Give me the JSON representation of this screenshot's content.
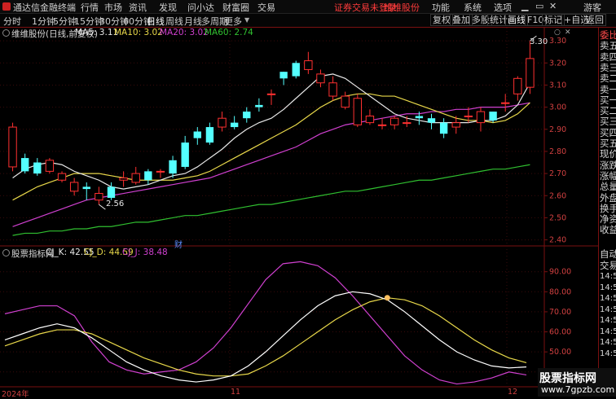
{
  "window": {
    "app_title": "通达信金融终端",
    "menu": [
      "行情",
      "市场",
      "资讯",
      "发现",
      "问小达",
      "财富圈",
      "交易"
    ],
    "login_notice": "证券交易未登录",
    "stock_name_red": "维维股份",
    "right_menu": [
      "功能",
      "系统",
      "选项"
    ],
    "guest": "游客"
  },
  "toolbar": {
    "timeframes": [
      "分时",
      "1分钟",
      "5分钟",
      "15分钟",
      "30分钟",
      "60分钟",
      "日线",
      "周线",
      "月线",
      "多周期",
      "更多"
    ],
    "active_timeframe": "日线",
    "tools": [
      "复权",
      "叠加",
      "多股",
      "统计",
      "画线",
      "F10",
      "标记",
      "+自选",
      "返回"
    ]
  },
  "main_chart": {
    "title": "维维股份(日线,前复权)",
    "ma_legend": [
      {
        "label": "MA5: 3.11",
        "color": "#e8e8e8"
      },
      {
        "label": "MA10: 3.02",
        "color": "#e8d84a"
      },
      {
        "label": "MA20: 3.02",
        "color": "#d040d0"
      },
      {
        "label": "MA60: 2.74",
        "color": "#30c030"
      }
    ],
    "high_label": "3.30",
    "low_label": "2.56",
    "cai_marker": "财",
    "y_ticks": [
      "3.30",
      "3.20",
      "3.10",
      "3.00",
      "2.90",
      "2.80",
      "2.70",
      "2.60",
      "2.50",
      "2.40"
    ],
    "y_min": 2.38,
    "y_max": 3.33
  },
  "indicator": {
    "title": "股票指标网",
    "values": [
      {
        "label": "CJ_K: 42.55",
        "color": "#e8e8e8"
      },
      {
        "label": "CJ_D: 44.59",
        "color": "#e8d84a"
      },
      {
        "label": "CJ_J: 38.48",
        "color": "#d040d0"
      }
    ],
    "y_ticks": [
      "90.00",
      "80.00",
      "70.00",
      "60.00",
      "50.00",
      "40.00"
    ],
    "y_min": 33,
    "y_max": 98
  },
  "x_axis": {
    "labels": [
      "2024年",
      "11",
      "12"
    ]
  },
  "right_panel": {
    "items": [
      "委比",
      "卖五",
      "卖四",
      "卖三",
      "卖二",
      "卖一",
      "买一",
      "买二",
      "买三",
      "买四",
      "买五",
      "现价",
      "涨跌",
      "涨幅",
      "总量",
      "外盘",
      "换手",
      "净资",
      "收益"
    ],
    "lower_items": [
      "自动",
      "交易",
      "14:50",
      "14:50",
      "14:50",
      "14:50",
      "14:50",
      "14:50",
      "14:50",
      "14:50"
    ]
  },
  "watermark": {
    "line1": "股票指标网",
    "line2": "www.7gpzb.com"
  },
  "chart_data": {
    "type": "candlestick",
    "open": [
      2.73,
      2.77,
      2.75,
      2.71,
      2.67,
      2.62,
      2.64,
      2.58,
      2.64,
      2.67,
      2.66,
      2.71,
      2.71,
      2.76,
      2.84,
      2.89,
      2.91,
      2.91,
      2.93,
      2.98,
      3.01,
      3.06,
      3.16,
      3.2,
      3.17,
      3.11,
      3.05,
      3.0,
      2.92,
      2.93,
      2.92,
      2.92,
      2.93,
      2.96,
      2.95,
      2.93,
      2.91,
      2.96,
      2.93,
      2.98,
      3.02,
      3.06,
      3.09
    ],
    "close": [
      2.91,
      2.71,
      2.7,
      2.76,
      2.7,
      2.66,
      2.63,
      2.61,
      2.59,
      2.68,
      2.7,
      2.67,
      2.71,
      2.7,
      2.73,
      2.86,
      2.84,
      2.95,
      2.91,
      2.95,
      3.0,
      3.06,
      3.13,
      3.14,
      3.21,
      3.15,
      3.11,
      3.05,
      3.04,
      2.96,
      2.92,
      2.95,
      2.93,
      2.95,
      2.93,
      2.88,
      2.93,
      2.96,
      2.98,
      2.94,
      3.02,
      3.13,
      3.22
    ],
    "high": [
      2.93,
      2.79,
      2.77,
      2.77,
      2.71,
      2.68,
      2.66,
      2.64,
      2.66,
      2.71,
      2.73,
      2.72,
      2.72,
      2.78,
      2.87,
      2.91,
      2.93,
      2.98,
      2.96,
      3.0,
      3.04,
      3.08,
      3.16,
      3.21,
      3.25,
      3.17,
      3.14,
      3.07,
      3.06,
      2.99,
      2.95,
      2.96,
      2.96,
      2.98,
      2.97,
      2.95,
      2.96,
      3.0,
      3.0,
      2.98,
      3.06,
      3.14,
      3.3
    ],
    "low": [
      2.71,
      2.7,
      2.69,
      2.7,
      2.66,
      2.6,
      2.58,
      2.56,
      2.58,
      2.64,
      2.65,
      2.65,
      2.68,
      2.68,
      2.72,
      2.83,
      2.83,
      2.89,
      2.9,
      2.93,
      2.98,
      3.01,
      3.1,
      3.13,
      3.15,
      3.09,
      3.03,
      2.99,
      2.91,
      2.92,
      2.9,
      2.9,
      2.91,
      2.92,
      2.9,
      2.86,
      2.88,
      2.93,
      2.89,
      2.93,
      2.98,
      3.03,
      3.06
    ],
    "ma5": [
      2.68,
      2.72,
      2.74,
      2.75,
      2.74,
      2.71,
      2.69,
      2.67,
      2.64,
      2.63,
      2.64,
      2.65,
      2.67,
      2.69,
      2.7,
      2.73,
      2.77,
      2.81,
      2.86,
      2.9,
      2.93,
      2.95,
      2.99,
      3.04,
      3.09,
      3.14,
      3.15,
      3.13,
      3.09,
      3.05,
      3.01,
      2.97,
      2.95,
      2.94,
      2.93,
      2.93,
      2.93,
      2.93,
      2.94,
      2.94,
      2.96,
      3.01,
      3.11
    ],
    "ma10": [
      2.58,
      2.61,
      2.64,
      2.66,
      2.68,
      2.7,
      2.7,
      2.7,
      2.69,
      2.68,
      2.67,
      2.67,
      2.67,
      2.67,
      2.68,
      2.69,
      2.71,
      2.74,
      2.77,
      2.8,
      2.83,
      2.86,
      2.89,
      2.92,
      2.96,
      3.0,
      3.03,
      3.05,
      3.06,
      3.06,
      3.05,
      3.05,
      3.03,
      3.01,
      2.99,
      2.97,
      2.95,
      2.94,
      2.94,
      2.93,
      2.94,
      2.97,
      3.02
    ],
    "ma20": [
      2.46,
      2.48,
      2.5,
      2.52,
      2.54,
      2.56,
      2.58,
      2.59,
      2.6,
      2.61,
      2.62,
      2.63,
      2.64,
      2.65,
      2.66,
      2.67,
      2.68,
      2.7,
      2.72,
      2.74,
      2.76,
      2.78,
      2.8,
      2.82,
      2.85,
      2.88,
      2.9,
      2.92,
      2.93,
      2.94,
      2.95,
      2.96,
      2.97,
      2.97,
      2.98,
      2.98,
      2.99,
      2.99,
      3.0,
      3.0,
      3.0,
      3.01,
      3.02
    ],
    "ma60": [
      2.42,
      2.43,
      2.43,
      2.44,
      2.44,
      2.45,
      2.45,
      2.46,
      2.46,
      2.47,
      2.48,
      2.48,
      2.49,
      2.5,
      2.51,
      2.51,
      2.52,
      2.53,
      2.54,
      2.55,
      2.56,
      2.56,
      2.57,
      2.58,
      2.59,
      2.6,
      2.61,
      2.62,
      2.62,
      2.63,
      2.64,
      2.65,
      2.66,
      2.67,
      2.67,
      2.68,
      2.69,
      2.7,
      2.71,
      2.72,
      2.72,
      2.73,
      2.74
    ],
    "cj_k": [
      56,
      59,
      62,
      64,
      62,
      57,
      51,
      45,
      41,
      38,
      36,
      35,
      36,
      38,
      43,
      50,
      58,
      66,
      73,
      78,
      80,
      79,
      76,
      70,
      63,
      56,
      50,
      46,
      43,
      42,
      42.5
    ],
    "cj_d": [
      53,
      56,
      59,
      61,
      61,
      59,
      55,
      51,
      47,
      44,
      41,
      39,
      38,
      38,
      39,
      43,
      48,
      54,
      60,
      66,
      71,
      75,
      77,
      76,
      73,
      68,
      62,
      56,
      51,
      47,
      44.6
    ],
    "cj_j": [
      69,
      71,
      73,
      73,
      68,
      55,
      45,
      41,
      39,
      40,
      41,
      45,
      52,
      62,
      74,
      86,
      94,
      95,
      93,
      87,
      78,
      68,
      58,
      48,
      41,
      36,
      34,
      35,
      37,
      40,
      38.5
    ]
  }
}
